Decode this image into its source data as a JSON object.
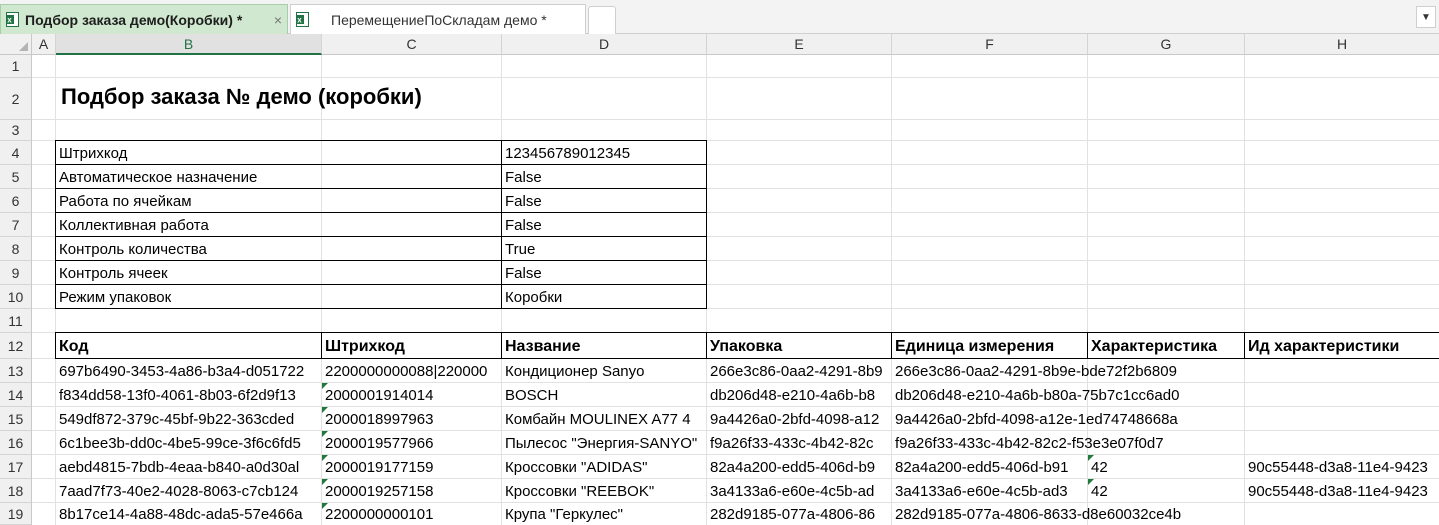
{
  "tabs": [
    {
      "label": "Подбор заказа демо(Коробки) *",
      "close": "×",
      "active": true
    },
    {
      "label": "ПеремещениеПоСкладам демо *",
      "active": false
    }
  ],
  "tab_menu_glyph": "▼",
  "columns": [
    "A",
    "B",
    "C",
    "D",
    "E",
    "F",
    "G",
    "H"
  ],
  "rows": [
    "1",
    "2",
    "3",
    "4",
    "5",
    "6",
    "7",
    "8",
    "9",
    "10",
    "11",
    "12",
    "13",
    "14",
    "15",
    "16",
    "17",
    "18",
    "19"
  ],
  "sheet": {
    "title": "Подбор заказа № демо (коробки)",
    "params": [
      {
        "name": "Штрихкод",
        "value": "123456789012345"
      },
      {
        "name": "Автоматическое назначение",
        "value": "False"
      },
      {
        "name": "Работа по ячейкам",
        "value": "False"
      },
      {
        "name": "Коллективная работа",
        "value": "False"
      },
      {
        "name": "Контроль количества",
        "value": "True"
      },
      {
        "name": "Контроль ячеек",
        "value": "False"
      },
      {
        "name": "Режим упаковок",
        "value": "Коробки"
      }
    ],
    "table_headers": [
      "Код",
      "Штрихкод",
      "Название",
      "Упаковка",
      "Единица измерения",
      "Характеристика",
      "Ид характеристики"
    ],
    "table_rows": [
      [
        "697b6490-3453-4a86-b3a4-d051722",
        "2200000000088|220000",
        "Кондиционер Sanyo",
        "266e3c86-0aa2-4291-8b9",
        "266e3c86-0aa2-4291-8b9e-bde72f2b6809",
        "",
        ""
      ],
      [
        "f834dd58-13f0-4061-8b03-6f2d9f13",
        "2000001914014",
        "BOSCH",
        "db206d48-e210-4a6b-b8",
        "db206d48-e210-4a6b-b80a-75b7c1cc6ad0",
        "",
        ""
      ],
      [
        "549df872-379c-45bf-9b22-363cded",
        "2000018997963",
        "Комбайн MOULINEX  A77 4",
        "9a4426a0-2bfd-4098-a12",
        "9a4426a0-2bfd-4098-a12e-1ed74748668a",
        "",
        ""
      ],
      [
        "6c1bee3b-dd0c-4be5-99ce-3f6c6fd5",
        "2000019577966",
        "Пылесос \"Энергия-SANYO\"",
        "f9a26f33-433c-4b42-82c",
        "f9a26f33-433c-4b42-82c2-f53e3e07f0d7",
        "",
        ""
      ],
      [
        "aebd4815-7bdb-4eaa-b840-a0d30al",
        "2000019177159",
        "Кроссовки \"ADIDAS\"",
        "82a4a200-edd5-406d-b9",
        "82a4a200-edd5-406d-b91",
        "42",
        "90c55448-d3a8-11e4-9423"
      ],
      [
        "7aad7f73-40e2-4028-8063-c7cb124",
        "2000019257158",
        "Кроссовки \"REEBOK\"",
        "3a4133a6-e60e-4c5b-ad",
        "3a4133a6-e60e-4c5b-ad3",
        "42",
        "90c55448-d3a8-11e4-9423"
      ],
      [
        "8b17ce14-4a88-48dc-ada5-57e466a",
        "2200000000101",
        "Крупа \"Геркулес\"",
        "282d9185-077a-4806-86",
        "282d9185-077a-4806-8633-d8e60032ce4b",
        "",
        ""
      ]
    ]
  }
}
